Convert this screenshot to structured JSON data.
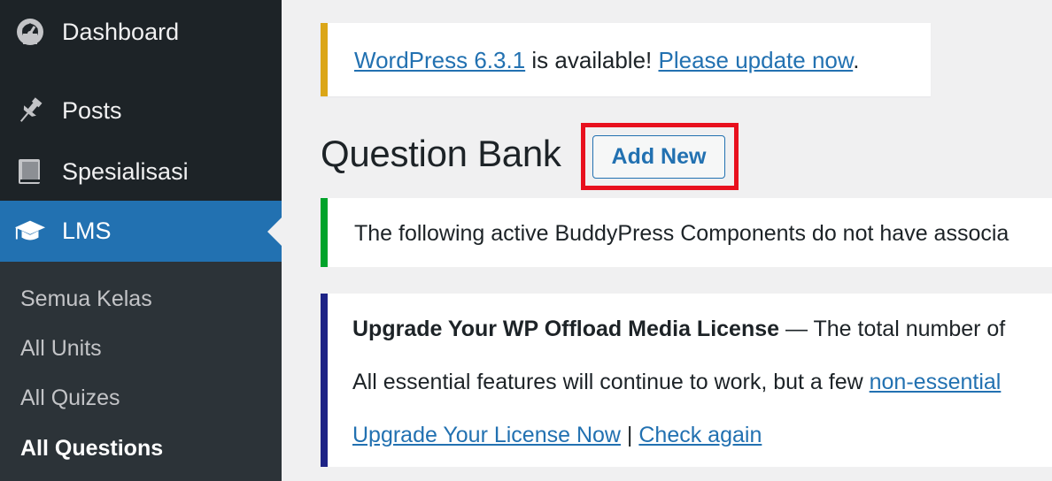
{
  "sidebar": {
    "items": [
      {
        "label": "Dashboard",
        "icon": "dashboard-icon"
      },
      {
        "label": "Posts",
        "icon": "pin-icon"
      },
      {
        "label": "Spesialisasi",
        "icon": "book-icon"
      },
      {
        "label": "LMS",
        "icon": "graduation-cap-icon"
      }
    ],
    "submenu": [
      {
        "label": "Semua Kelas"
      },
      {
        "label": "All Units"
      },
      {
        "label": "All Quizes"
      },
      {
        "label": "All Questions"
      }
    ]
  },
  "update_notice": {
    "link1": "WordPress 6.3.1",
    "text": " is available! ",
    "link2": "Please update now",
    "end": "."
  },
  "page": {
    "title": "Question Bank",
    "add_new_label": "Add New"
  },
  "buddypress_notice": {
    "text": "The following active BuddyPress Components do not have associa"
  },
  "offload_notice": {
    "title": "Upgrade Your WP Offload Media License",
    "dash_text": " — The total number of",
    "line2_text": "All essential features will continue to work, but a few ",
    "line2_link": "non-essential",
    "link_upgrade": "Upgrade Your License Now",
    "separator": " | ",
    "link_check": "Check again"
  },
  "colors": {
    "sidebar_bg": "#1d2327",
    "active_bg": "#2271b1",
    "update_border": "#dba617",
    "success_border": "#00a32a",
    "offload_border": "#1d2386",
    "highlight": "#e8101e"
  }
}
